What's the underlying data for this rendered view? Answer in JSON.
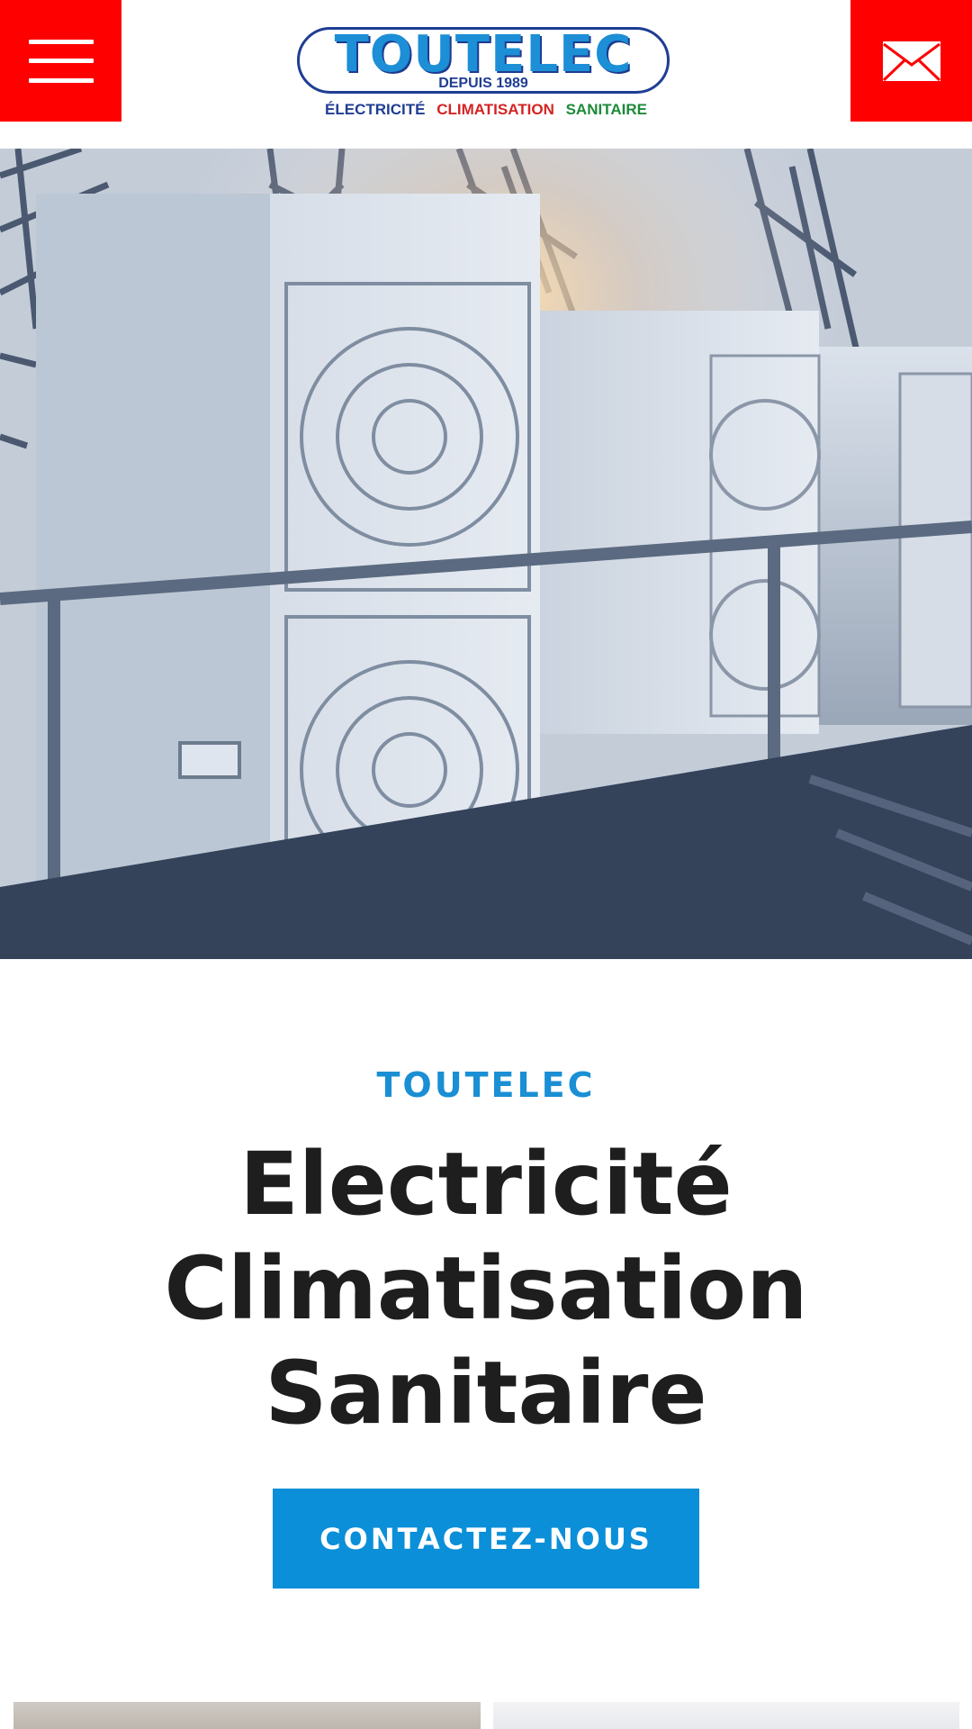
{
  "header": {
    "menu_icon": "hamburger-menu-icon",
    "mail_icon": "envelope-icon",
    "brand_color": "#ff0000",
    "logo": {
      "name": "TOUTELEC",
      "since": "DEPUIS 1989",
      "tags": [
        {
          "label": "ÉLECTRICITÉ",
          "color": "#1f3d93"
        },
        {
          "label": "CLIMATISATION",
          "color": "#d42323"
        },
        {
          "label": "SANITAIRE",
          "color": "#1d8a3a"
        }
      ]
    }
  },
  "hero": {
    "image": "rooftop-air-conditioning-units-photo"
  },
  "intro": {
    "kicker": "TOUTELEC",
    "headline_lines": [
      "Electricité",
      "Climatisation",
      "Sanitaire"
    ],
    "accent_color": "#1a8fd4"
  },
  "cta": {
    "label": "CONTACTEZ-NOUS",
    "color": "#0b8fd8"
  },
  "cards": [
    {
      "image": "service-card-image-left"
    },
    {
      "image": "service-card-image-right"
    }
  ]
}
